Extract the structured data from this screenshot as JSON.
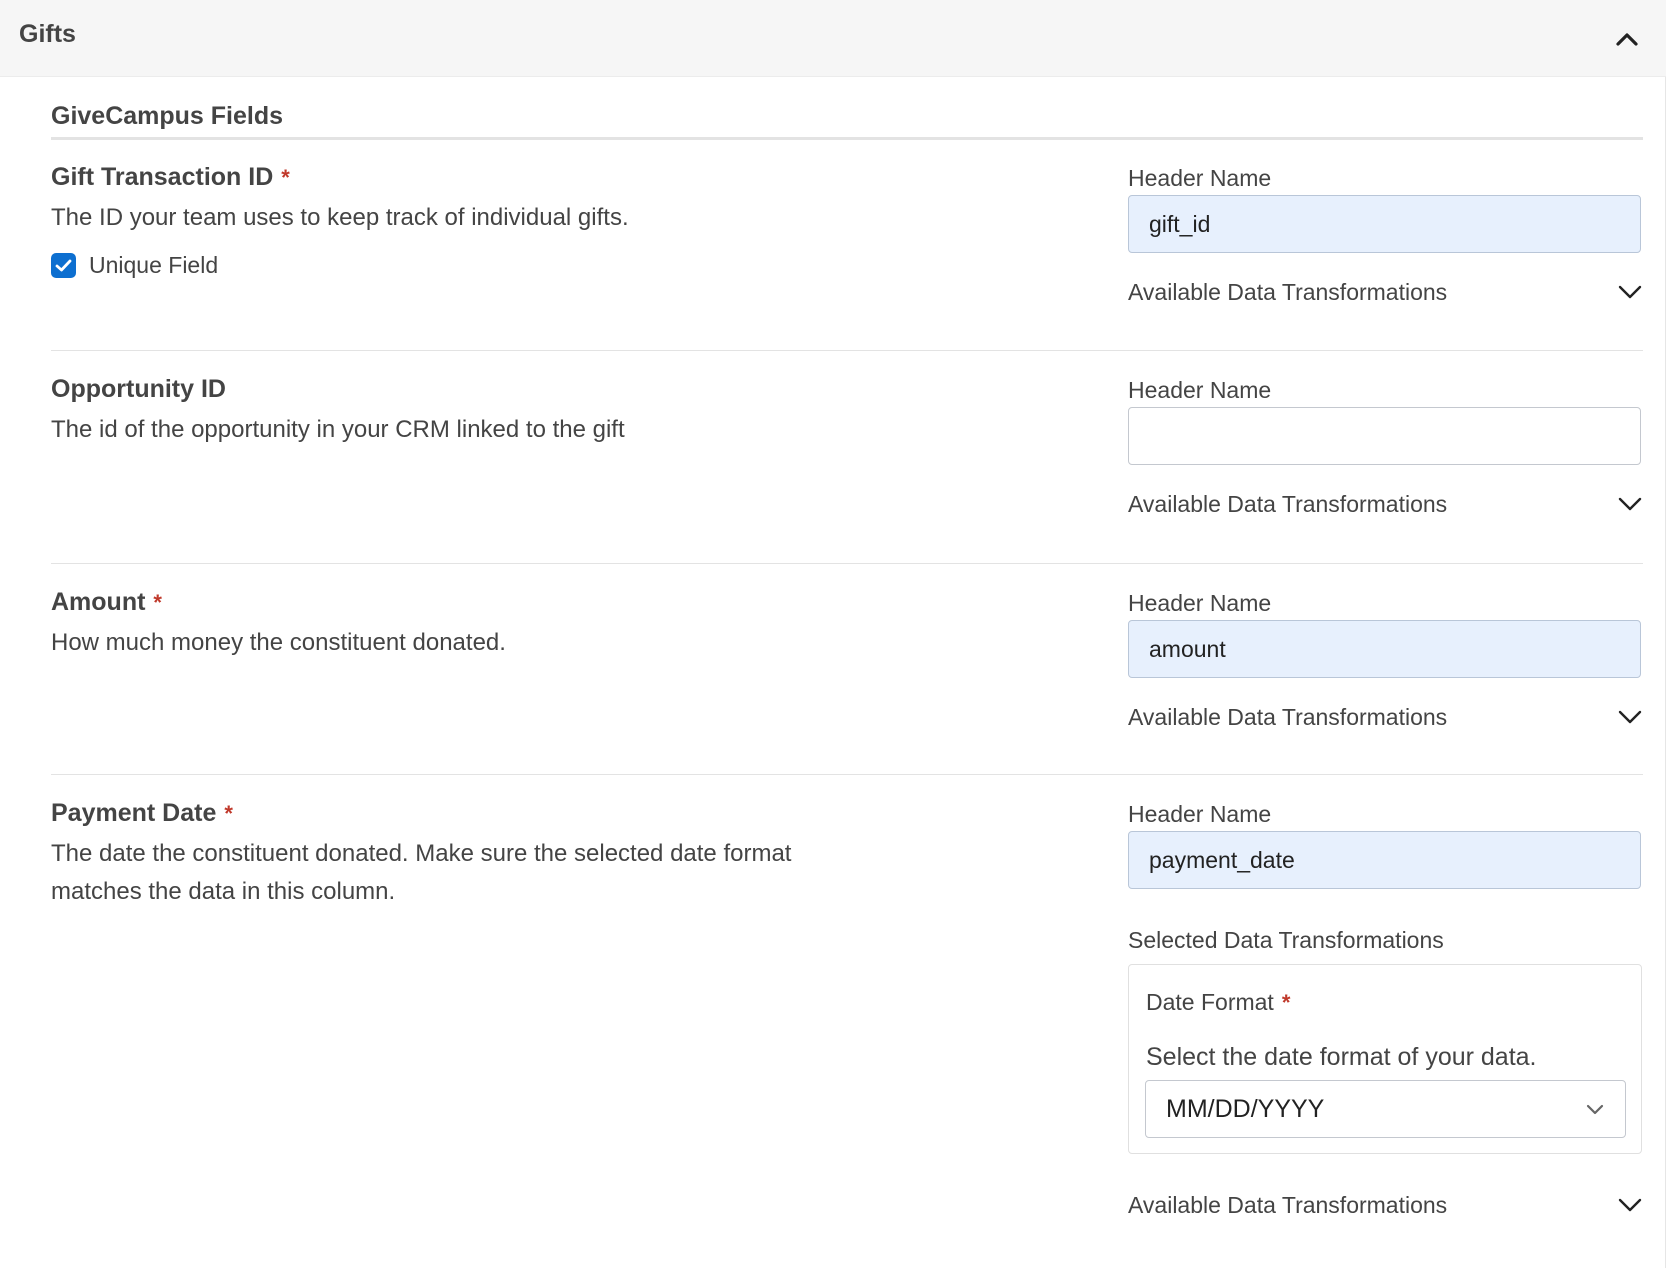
{
  "panel": {
    "title": "Gifts",
    "collapse_icon": "chevron-up-icon"
  },
  "section": {
    "title": "GiveCampus Fields"
  },
  "common": {
    "header_name_label": "Header Name",
    "available_transformations_label": "Available Data Transformations",
    "selected_transformations_label": "Selected Data Transformations",
    "required_marker": "*"
  },
  "fields": [
    {
      "label": "Gift Transaction ID",
      "required": true,
      "description": "The ID your team uses to keep track of individual gifts.",
      "unique_field_label": "Unique Field",
      "unique_checked": true,
      "header_value": "gift_id"
    },
    {
      "label": "Opportunity ID",
      "required": false,
      "description": "The id of the opportunity in your CRM linked to the gift",
      "header_value": ""
    },
    {
      "label": "Amount",
      "required": true,
      "description": "How much money the constituent donated.",
      "header_value": "amount"
    },
    {
      "label": "Payment Date",
      "required": true,
      "description": "The date the constituent donated. Make sure the selected date format matches the data in this column.",
      "header_value": "payment_date",
      "selected_transformation": {
        "title": "Date Format",
        "required": true,
        "description": "Select the date format of your data.",
        "selected_value": "MM/DD/YYYY"
      }
    }
  ],
  "colors": {
    "accent": "#0d6fd0",
    "required": "#c0392b",
    "filled_input_bg": "#e7f0fd",
    "header_bg": "#f6f6f6"
  }
}
